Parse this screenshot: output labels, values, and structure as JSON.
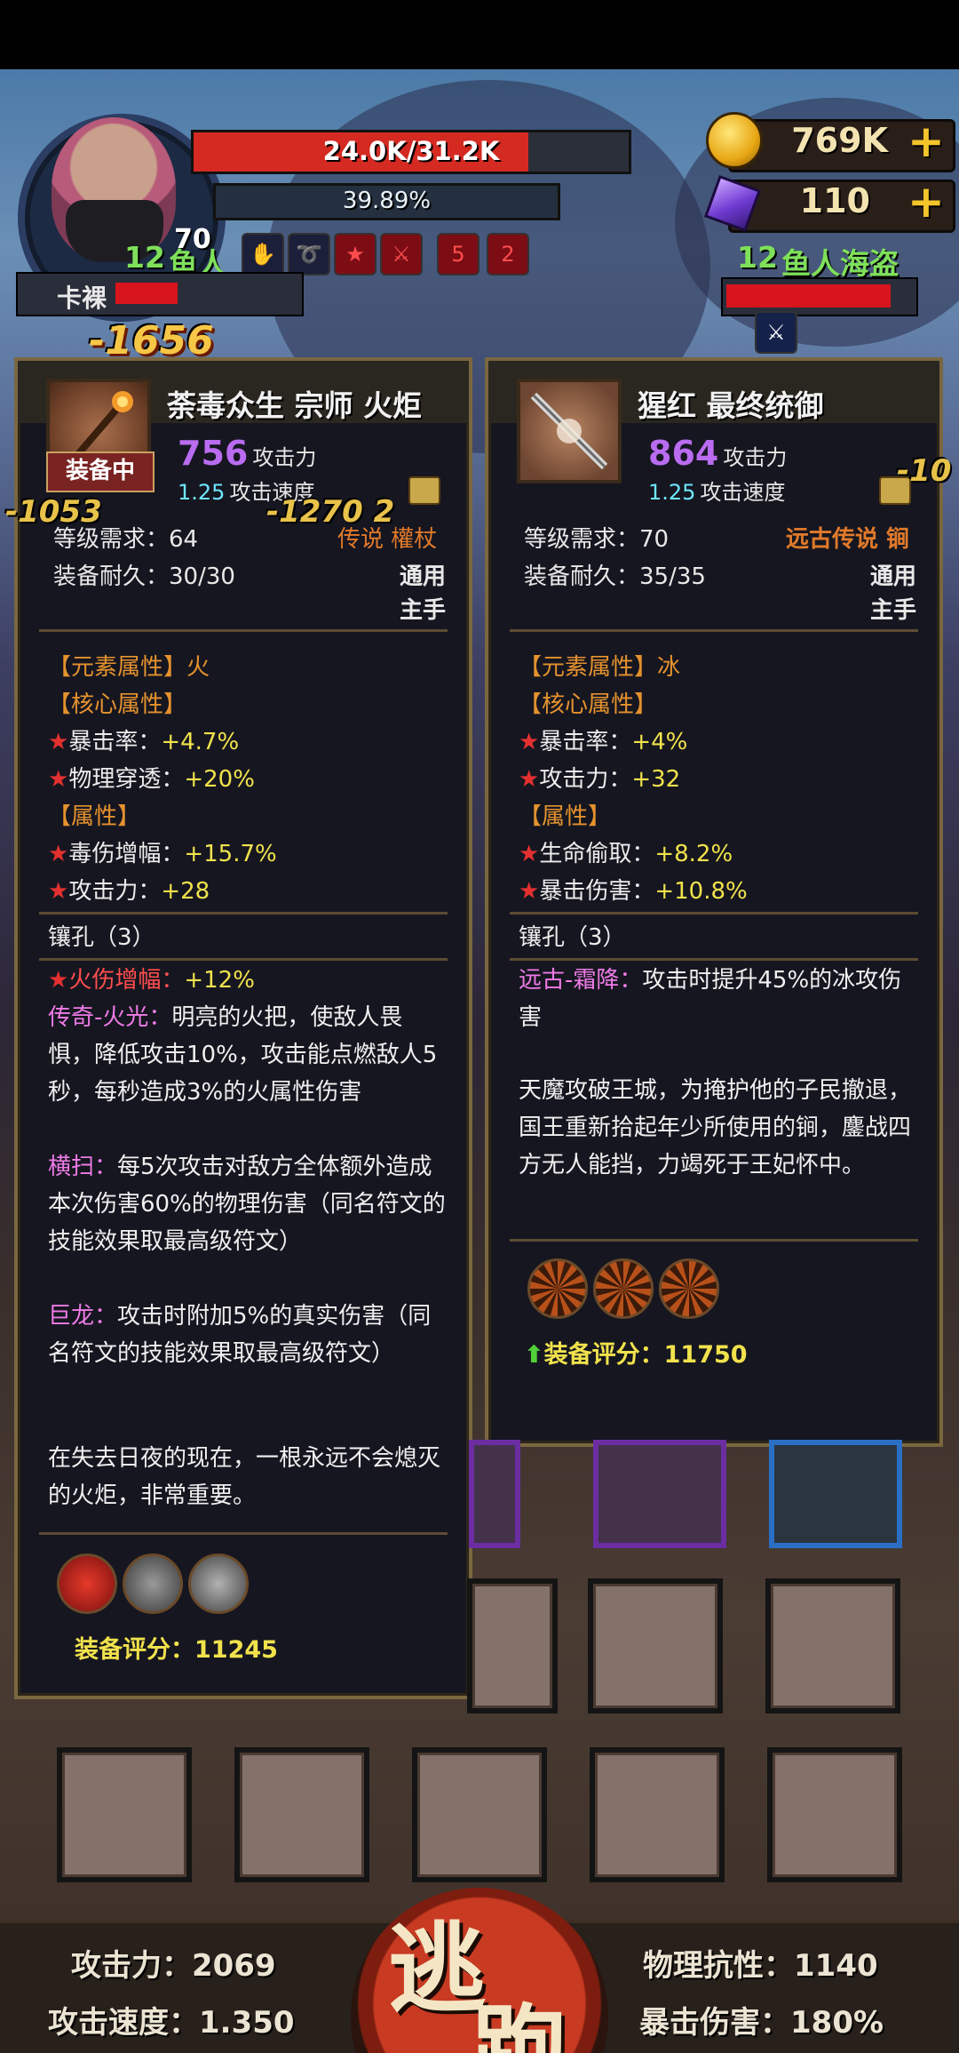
{
  "player": {
    "hp_text": "24.0K/31.2K",
    "hp_fraction": 0.77,
    "exp_text": "39.89%",
    "level": "12",
    "name": "鱼人",
    "level_badge": "70",
    "damage_float": "-1656",
    "buff_icons": [
      "hand-down-icon",
      "swirl-icon",
      "star-up-icon",
      "sword-up-icon",
      "blade-5-icon",
      "hit-2-icon"
    ]
  },
  "currency": {
    "gold": "769K",
    "gems": "110",
    "plus": "+"
  },
  "enemy": {
    "label": "卡裸",
    "right_level": "12",
    "right_name": "鱼人海盗",
    "hp_fraction": 0.85
  },
  "left_card": {
    "title": "荼毒众生 宗师 火炬",
    "equipped_label": "装备中",
    "attack": "756",
    "attack_label": "攻击力",
    "speed": "1.25",
    "speed_label": "攻击速度",
    "level_req_label": "等级需求：",
    "level_req": "64",
    "durability_label": "装备耐久：",
    "durability": "30/30",
    "rarity": "传说 權杖",
    "usage": "通用",
    "slot": "主手",
    "float_dmg_1": "-1053",
    "float_dmg_2": "-1270 2",
    "element": "【元素属性】火",
    "core_header": "【核心属性】",
    "core_1_label": "暴击率：",
    "core_1_value": "+4.7%",
    "core_2_label": "物理穿透：",
    "core_2_value": "+20%",
    "attr_header": "【属性】",
    "attr_1_label": "毒伤增幅：",
    "attr_1_value": "+15.7%",
    "attr_2_label": "攻击力：",
    "attr_2_value": "+28",
    "socket_label": "镶孔（3）",
    "socket_1_label": "火伤增幅：",
    "socket_1_value": "+12%",
    "skill_1_name": "传奇-火光：",
    "skill_1_desc": "明亮的火把，使敌人畏惧，降低攻击10%，攻击能点燃敌人5秒，每秒造成3%的火属性伤害",
    "skill_2_name": "横扫：",
    "skill_2_desc": "每5次攻击对敌方全体额外造成本次伤害60%的物理伤害（同名符文的技能效果取最高级符文）",
    "skill_3_name": "巨龙：",
    "skill_3_desc": "攻击时附加5%的真实伤害（同名符文的技能效果取最高级符文）",
    "lore": "在失去日夜的现在，一根永远不会熄灭的火炬，非常重要。",
    "score_label": "装备评分：",
    "score": "11245"
  },
  "right_card": {
    "title": "猩红 最终统御",
    "attack": "864",
    "attack_label": "攻击力",
    "speed": "1.25",
    "speed_label": "攻击速度",
    "level_req_label": "等级需求：",
    "level_req": "70",
    "durability_label": "装备耐久：",
    "durability": "35/35",
    "rarity": "远古传说 锏",
    "usage": "通用",
    "slot": "主手",
    "float_dmg": "-10",
    "element": "【元素属性】冰",
    "core_header": "【核心属性】",
    "core_1_label": "暴击率：",
    "core_1_value": "+4%",
    "core_2_label": "攻击力：",
    "core_2_value": "+32",
    "attr_header": "【属性】",
    "attr_1_label": "生命偷取：",
    "attr_1_value": "+8.2%",
    "attr_2_label": "暴击伤害：",
    "attr_2_value": "+10.8%",
    "socket_label": "镶孔（3）",
    "skill_1_name": "远古-霜降：",
    "skill_1_desc": "攻击时提升45%的冰攻伤害",
    "lore": "天魔攻破王城，为掩护他的子民撤退，国王重新拾起年少所使用的锏，鏖战四方无人能挡，力竭死于王妃怀中。",
    "score_label": "装备评分：",
    "score": "11750"
  },
  "stats": {
    "attack_label": "攻击力：",
    "attack": "2069",
    "speed_label": "攻击速度：",
    "speed": "1.350",
    "phys_res_label": "物理抗性：",
    "phys_res": "1140",
    "crit_dmg_label": "暴击伤害：",
    "crit_dmg": "180%"
  },
  "flee": {
    "char_1": "逃",
    "char_2": "跑"
  },
  "colors": {
    "hp": "#d42a22",
    "gold": "#f4c52b",
    "legendary": "#e07a2a",
    "attack": "#b96cf0",
    "score": "#f1e24c"
  }
}
